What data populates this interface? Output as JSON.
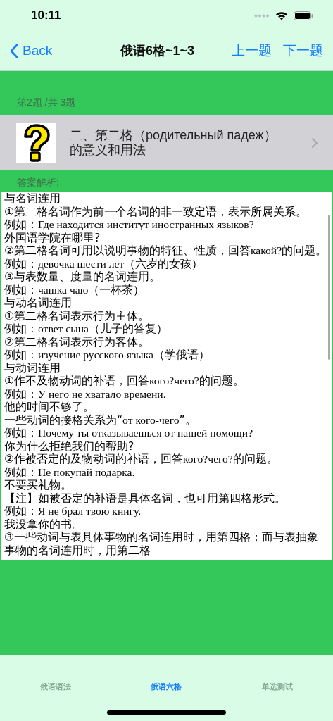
{
  "status_bar": {
    "time": "10:11"
  },
  "nav": {
    "back": "Back",
    "title": "俄语6格~1~3",
    "prev": "上一题",
    "next": "下一题"
  },
  "progress": "第2题 /共 3题",
  "question": {
    "title": "二、第二格（родительный падеж）的意义和用法"
  },
  "answer": {
    "heading": "答案解析:",
    "lines": [
      "与名词连用",
      "①第二格名词作为前一个名词的非一致定语，表示所属关系。",
      "例如：Где находится институт иностранных языков?",
      "外国语学院在哪里?",
      "②第二格名词可用以说明事物的特征、性质，回答какой?的问题。",
      "例如：девочка шести лет（六岁的女孩）",
      "③与表数量、度量的名词连用。",
      "例如：чашка чаю（一杯茶）",
      "与动名词连用",
      "①第二格名词表示行为主体。",
      "例如：ответ сына（儿子的答复）",
      "②第二格名词表示行为客体。",
      "例如：изучение русского языка（学俄语）",
      "与动词连用",
      "①作不及物动词的补语，回答кого?чего?的问题。",
      "例如：У него не хватало времени.",
      "他的时间不够了。",
      "一些动词的接格关系为“от кого-чего”。",
      "例如：Почему ты отказываешься от нашей помощи?",
      "你为什么拒绝我们的帮助?",
      "②作被否定的及物动词的补语，回答кого?чего?的问题。",
      "例如：Не покупай подарка.",
      "不要买礼物。",
      "【注】如被否定的补语是具体名词，也可用第四格形式。",
      "例如：Я не брал твою книгу.",
      "我没拿你的书。",
      "③一些动词与表具体事物的名词连用时，用第四格；而与表抽象",
      "事物的名词连用时，用第二格"
    ]
  },
  "tabs": [
    {
      "label": "俄语语法",
      "selected": false
    },
    {
      "label": "俄语六格",
      "selected": true
    },
    {
      "label": "单选测试",
      "selected": false
    }
  ]
}
